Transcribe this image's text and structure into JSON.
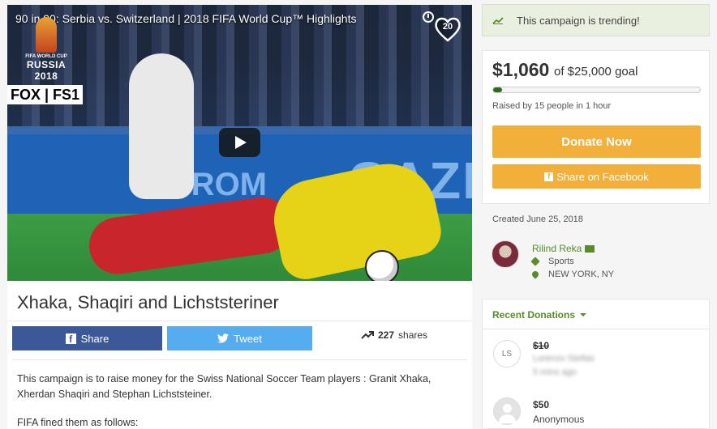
{
  "video": {
    "title": "90 in 90: Serbia vs. Switzerland | 2018 FIFA World Cup™ Highlights",
    "wc_logo_small": "FIFA WORLD CUP",
    "wc_logo_big": "RUSSIA 2018",
    "broadcaster": "FOX | FS1",
    "heart_count": "20",
    "board_text_1": "GAZP",
    "board_text_2": "PROM",
    "board_text_3": "M"
  },
  "campaign": {
    "title": "Xhaka, Shaqiri and Lichststeriner",
    "share_label": "Share",
    "tweet_label": "Tweet",
    "share_count": "227",
    "share_count_suffix": "shares",
    "description": "This campaign is to raise money for the Swiss National Soccer Team players : Granit Xhaka, Xherdan Shaqiri and Stephan Lichststeiner.",
    "description_2": "FIFA  fined them as follows:"
  },
  "sidebar": {
    "trending": "This campaign is trending!",
    "raised_amount": "$1,060",
    "goal_text": "of $25,000 goal",
    "progress_fraction": 0.0424,
    "raised_by": "Raised by 15 people in 1 hour",
    "donate_label": "Donate Now",
    "fb_share_label": "Share on Facebook",
    "created": "Created June 25, 2018",
    "organizer": {
      "name": "Rilind Reka",
      "category": "Sports",
      "location": "NEW YORK, NY"
    },
    "recent_donations_label": "Recent Donations",
    "donations": [
      {
        "initials": "LS",
        "amount": "$10",
        "name": "Lorenzo Stellas",
        "time": "5 mins ago"
      },
      {
        "initials": "",
        "amount": "$50",
        "name": "Anonymous",
        "time": ""
      }
    ]
  },
  "colors": {
    "brand_green": "#5a8a2a",
    "donate_orange": "#f2b03a",
    "facebook_blue": "#3b5998",
    "twitter_blue": "#55acee",
    "progress_green": "#2f6a22"
  }
}
